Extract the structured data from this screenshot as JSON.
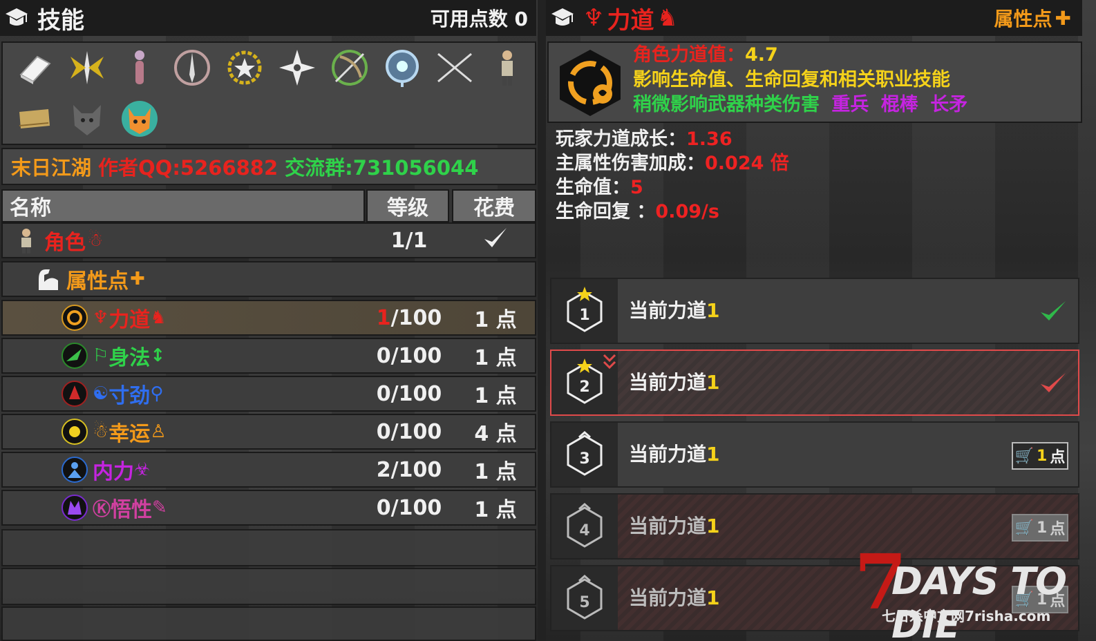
{
  "left": {
    "header": {
      "title": "技能",
      "points_label": "可用点数 0"
    },
    "icons": [
      "book-icon",
      "winged-sword-icon",
      "doll-icon",
      "dagger-icon",
      "badge-icon",
      "shuriken-icon",
      "crossed-bow-icon",
      "orb-icon",
      "crossed-blades-icon",
      "survivor-icon",
      "scroll-icon",
      "wolf-icon",
      "cat-icon"
    ],
    "banner": {
      "part1": "末日江湖",
      "part2": "作者QQ:5266882",
      "part3": "交流群:731056044"
    },
    "table": {
      "col_name": "名称",
      "col_level": "等级",
      "col_cost": "花费",
      "role_row": {
        "name": "角色",
        "level": "1/1"
      },
      "attr_row": {
        "name": "属性点"
      },
      "skills": [
        {
          "name": "力道",
          "level_cur": "1",
          "level_max": "/100",
          "cost": "1 点",
          "color": "#e8231e"
        },
        {
          "name": "身法",
          "level": "0/100",
          "cost": "1 点",
          "color": "#2fd24a"
        },
        {
          "name": "寸劲",
          "level": "0/100",
          "cost": "1 点",
          "color": "#2f6ef0"
        },
        {
          "name": "幸运",
          "level": "0/100",
          "cost": "4 点",
          "color": "#f39a1a"
        },
        {
          "name": "内力",
          "level": "2/100",
          "cost": "1 点",
          "color": "#c524e0"
        },
        {
          "name": "悟性",
          "level": "0/100",
          "cost": "1 点",
          "color": "#d040a0"
        }
      ]
    }
  },
  "right": {
    "header": {
      "title": "力道",
      "attr_label": "属性点"
    },
    "info": {
      "line1_label": "角色力道值：",
      "line1_value": "4.7",
      "line2": "影响生命值、生命回复和相关职业技能",
      "line3_label": "稍微影响武器种类伤害",
      "line3_w1": "重兵",
      "line3_w2": "棍棒",
      "line3_w3": "长矛"
    },
    "stats": [
      {
        "label": "玩家力道成长：",
        "value": "1.36"
      },
      {
        "label": "主属性伤害加成：",
        "value": "0.024 倍"
      },
      {
        "label": "生命值：",
        "value": "5"
      },
      {
        "label": "生命回复 ：",
        "value": "0.09/s"
      }
    ],
    "levels": [
      {
        "num": "1",
        "text": "当前力道",
        "val": "1"
      },
      {
        "num": "2",
        "text": "当前力道",
        "val": "1"
      },
      {
        "num": "3",
        "text": "当前力道",
        "val": "1",
        "buy": "1",
        "buy_unit": "点"
      },
      {
        "num": "4",
        "text": "当前力道",
        "val": "1",
        "buy": "1",
        "buy_unit": "点"
      },
      {
        "num": "5",
        "text": "当前力道",
        "val": "1",
        "buy": "1",
        "buy_unit": "点"
      }
    ],
    "logo": {
      "seven": "7",
      "days": "DAYS TO DIE",
      "sub": "七日杀中文网7risha.com"
    }
  }
}
